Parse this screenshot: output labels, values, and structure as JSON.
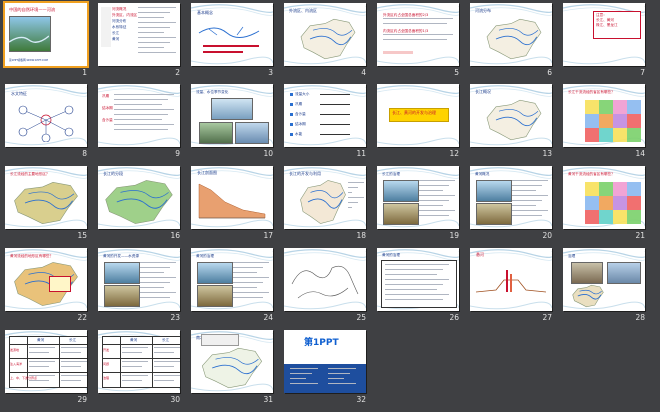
{
  "app": {
    "view": "slide-sorter",
    "background_color": "#3f4043",
    "accent_color": "#c8102e",
    "selection_color": "#f0a020"
  },
  "slides": [
    {
      "n": "1",
      "kind": "cover",
      "title": "中国的自然环境——河流",
      "footer": "第1PPT模板网-WWW.1PPT.COM"
    },
    {
      "n": "2",
      "kind": "outline",
      "lines": [
        "河流概况",
        "外流区、内流区",
        "河流分布",
        "水系特征",
        "长江",
        "黄河"
      ]
    },
    {
      "n": "3",
      "kind": "diagram",
      "title": "基本概念"
    },
    {
      "n": "4",
      "kind": "map",
      "title": "外流区、内流区"
    },
    {
      "n": "5",
      "kind": "text",
      "lines": [
        "外流区约占全国总面积的2/3",
        "内流区约占全国总面积的1/3"
      ]
    },
    {
      "n": "6",
      "kind": "map",
      "title": "河流分布"
    },
    {
      "n": "7",
      "kind": "text",
      "lines": [
        "注意：",
        "长江、黄河",
        "珠江、黑龙江"
      ]
    },
    {
      "n": "8",
      "kind": "diagram",
      "title": "水文特征"
    },
    {
      "n": "9",
      "kind": "text",
      "lines": [
        "汛期",
        "结冰期",
        "含沙量"
      ]
    },
    {
      "n": "10",
      "kind": "photo",
      "title": "流量、水位季节变化"
    },
    {
      "n": "11",
      "kind": "list",
      "lines": [
        "流量大小",
        "汛期",
        "含沙量",
        "结冰期",
        "水能"
      ]
    },
    {
      "n": "12",
      "kind": "banner",
      "title": "长江、黄河的开发与治理"
    },
    {
      "n": "13",
      "kind": "map",
      "title": "长江概况"
    },
    {
      "n": "14",
      "kind": "map",
      "title": "长江干流流经的省区有哪些？"
    },
    {
      "n": "15",
      "kind": "map",
      "title": "长江流经的主要地形区？"
    },
    {
      "n": "16",
      "kind": "map",
      "title": "长江的分段"
    },
    {
      "n": "17",
      "kind": "chart",
      "title": "长江剖面图"
    },
    {
      "n": "18",
      "kind": "map",
      "title": "长江的开发与利用"
    },
    {
      "n": "19",
      "kind": "photo",
      "title": "长江的治理"
    },
    {
      "n": "20",
      "kind": "photo",
      "title": "黄河概况"
    },
    {
      "n": "21",
      "kind": "map",
      "title": "黄河干流流经的省区有哪些？"
    },
    {
      "n": "22",
      "kind": "map",
      "title": "黄河流经的地形区有哪些？"
    },
    {
      "n": "23",
      "kind": "photo",
      "title": "黄河的开发——水资源"
    },
    {
      "n": "24",
      "kind": "photo",
      "title": "黄河的治理"
    },
    {
      "n": "25",
      "kind": "map",
      "title": ""
    },
    {
      "n": "26",
      "kind": "table",
      "title": "黄河的治理"
    },
    {
      "n": "27",
      "kind": "chart",
      "title": "悬河"
    },
    {
      "n": "28",
      "kind": "photo",
      "title": "治理"
    },
    {
      "n": "29",
      "kind": "table",
      "headers": [
        "黄河",
        "长江"
      ],
      "rows": [
        "发源地",
        "注入海洋",
        "上、中、下游分界点"
      ]
    },
    {
      "n": "30",
      "kind": "table",
      "headers": [
        "黄河",
        "长江"
      ],
      "rows": [
        "开发",
        "问题",
        "治理"
      ]
    },
    {
      "n": "31",
      "kind": "map",
      "title": "南水北调"
    },
    {
      "n": "32",
      "kind": "brand",
      "title": "第1PPT"
    }
  ]
}
